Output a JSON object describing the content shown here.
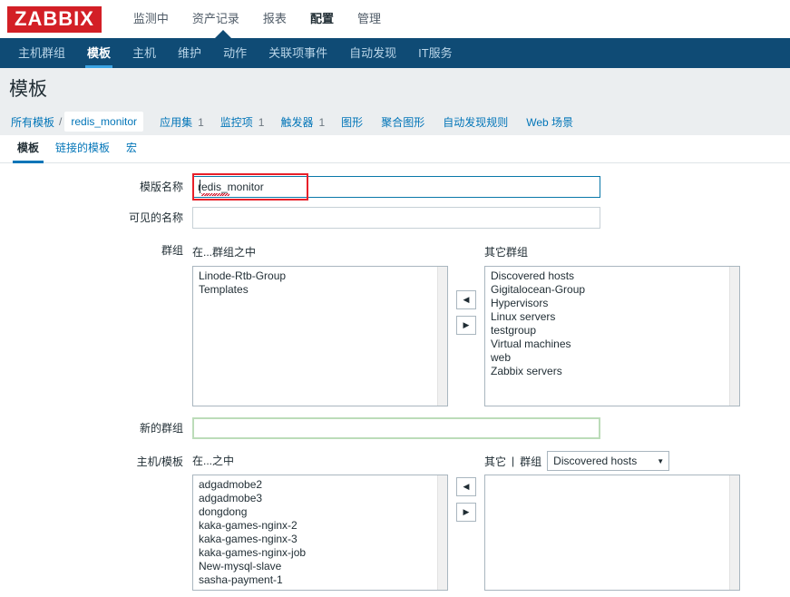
{
  "brand": {
    "logo_text": "ZABBIX",
    "logo_bg": "#d31f26"
  },
  "main_menu": [
    {
      "label": "监测中",
      "selected": false
    },
    {
      "label": "资产记录",
      "selected": false
    },
    {
      "label": "报表",
      "selected": false
    },
    {
      "label": "配置",
      "selected": true
    },
    {
      "label": "管理",
      "selected": false
    }
  ],
  "sub_menu": [
    {
      "label": "主机群组",
      "selected": false
    },
    {
      "label": "模板",
      "selected": true
    },
    {
      "label": "主机",
      "selected": false
    },
    {
      "label": "维护",
      "selected": false
    },
    {
      "label": "动作",
      "selected": false
    },
    {
      "label": "关联项事件",
      "selected": false
    },
    {
      "label": "自动发现",
      "selected": false
    },
    {
      "label": "IT服务",
      "selected": false
    }
  ],
  "page": {
    "title": "模板"
  },
  "breadcrumb": {
    "root": "所有模板",
    "separator": "/",
    "current": "redis_monitor",
    "links": [
      {
        "label": "应用集",
        "count": "1"
      },
      {
        "label": "监控项",
        "count": "1"
      },
      {
        "label": "触发器",
        "count": "1"
      },
      {
        "label": "图形",
        "count": ""
      },
      {
        "label": "聚合图形",
        "count": ""
      },
      {
        "label": "自动发现规则",
        "count": ""
      },
      {
        "label": "Web 场景",
        "count": ""
      }
    ]
  },
  "tabs": [
    {
      "label": "模板",
      "selected": true
    },
    {
      "label": "链接的模板",
      "selected": false
    },
    {
      "label": "宏",
      "selected": false
    }
  ],
  "form": {
    "template_name": {
      "label": "模版名称",
      "value": "redis_monitor",
      "placeholder": ""
    },
    "visible_name": {
      "label": "可见的名称",
      "value": "",
      "placeholder": ""
    },
    "groups": {
      "label": "群组",
      "left_caption": "在...群组之中",
      "right_caption": "其它群组",
      "left_items": [
        "Linode-Rtb-Group",
        "Templates"
      ],
      "right_items": [
        "Discovered hosts",
        "Gigitalocean-Group",
        "Hypervisors",
        "Linux servers",
        "testgroup",
        "Virtual machines",
        "web",
        "Zabbix servers"
      ],
      "move_left_icon": "triangle-left-icon",
      "move_right_icon": "triangle-right-icon",
      "move_left_glyph": "◀",
      "move_right_glyph": "▶"
    },
    "new_group": {
      "label": "新的群组",
      "value": "",
      "placeholder": ""
    },
    "host_templates": {
      "label": "主机/模板",
      "left_caption": "在...之中",
      "right_caption_a": "其它",
      "right_caption_sep": "|",
      "right_caption_b": "群组",
      "group_select_value": "Discovered hosts",
      "group_select_arrow": "▼",
      "left_items": [
        "adgadmobe2",
        "adgadmobe3",
        "dongdong",
        "kaka-games-nginx-2",
        "kaka-games-nginx-3",
        "kaka-games-nginx-job",
        "New-mysql-slave",
        "sasha-payment-1"
      ],
      "right_items": []
    }
  },
  "colors": {
    "brand_red": "#d31f26",
    "nav_dark": "#0f4b75",
    "accent_blue": "#0275b8",
    "tab_underline": "#3aa3e3",
    "annotation_red": "#e8202a",
    "highlight_green": "#bcdcb9",
    "page_head_bg": "#ebeef0"
  }
}
